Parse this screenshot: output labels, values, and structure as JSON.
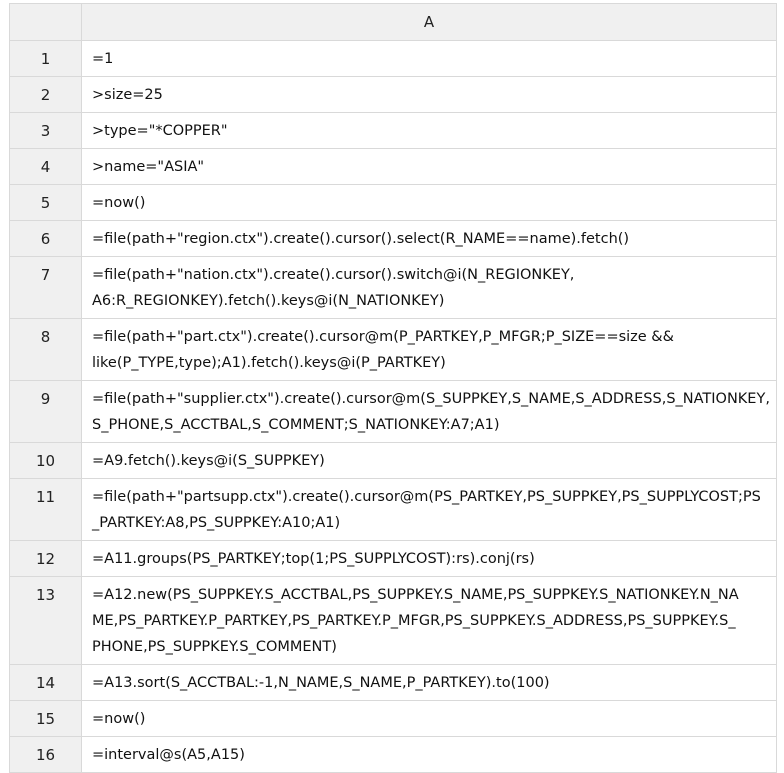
{
  "header": {
    "column_a": "A"
  },
  "rows": [
    {
      "num": "1",
      "code": "=1"
    },
    {
      "num": "2",
      "code": ">size=25"
    },
    {
      "num": "3",
      "code": ">type=\"*COPPER\""
    },
    {
      "num": "4",
      "code": ">name=\"ASIA\""
    },
    {
      "num": "5",
      "code": "=now()"
    },
    {
      "num": "6",
      "code": "=file(path+\"region.ctx\").create().cursor().select(R_NAME==name).fetch()"
    },
    {
      "num": "7",
      "code": "=file(path+\"nation.ctx\").create().cursor().switch@i(N_REGIONKEY,\nA6:R_REGIONKEY).fetch().keys@i(N_NATIONKEY)"
    },
    {
      "num": "8",
      "code": "=file(path+\"part.ctx\").create().cursor@m(P_PARTKEY,P_MFGR;P_SIZE==size   &&\nlike(P_TYPE,type);A1).fetch().keys@i(P_PARTKEY)"
    },
    {
      "num": "9",
      "code": "=file(path+\"supplier.ctx\").create().cursor@m(S_SUPPKEY,S_NAME,S_ADDRESS,S_NATIONKEY,\nS_PHONE,S_ACCTBAL,S_COMMENT;S_NATIONKEY:A7;A1)"
    },
    {
      "num": "10",
      "code": "=A9.fetch().keys@i(S_SUPPKEY)"
    },
    {
      "num": "11",
      "code": "=file(path+\"partsupp.ctx\").create().cursor@m(PS_PARTKEY,PS_SUPPKEY,PS_SUPPLYCOST;PS\n_PARTKEY:A8,PS_SUPPKEY:A10;A1)"
    },
    {
      "num": "12",
      "code": "=A11.groups(PS_PARTKEY;top(1;PS_SUPPLYCOST):rs).conj(rs)"
    },
    {
      "num": "13",
      "code": "=A12.new(PS_SUPPKEY.S_ACCTBAL,PS_SUPPKEY.S_NAME,PS_SUPPKEY.S_NATIONKEY.N_NA\nME,PS_PARTKEY.P_PARTKEY,PS_PARTKEY.P_MFGR,PS_SUPPKEY.S_ADDRESS,PS_SUPPKEY.S_\nPHONE,PS_SUPPKEY.S_COMMENT)"
    },
    {
      "num": "14",
      "code": "=A13.sort(S_ACCTBAL:-1,N_NAME,S_NAME,P_PARTKEY).to(100)"
    },
    {
      "num": "15",
      "code": "=now()"
    },
    {
      "num": "16",
      "code": "=interval@s(A5,A15)"
    }
  ]
}
